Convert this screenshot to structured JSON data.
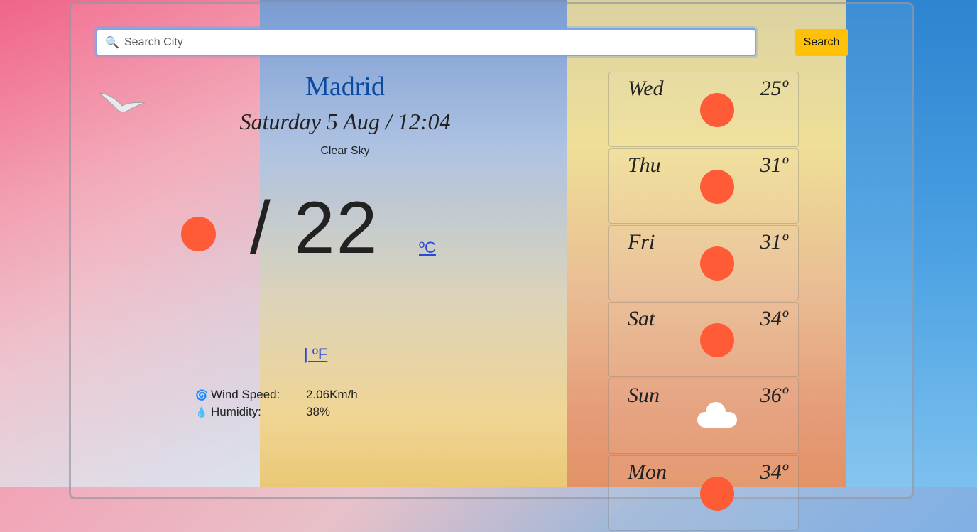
{
  "search": {
    "placeholder": "Search City",
    "button_label": "Search"
  },
  "current": {
    "city": "Madrid",
    "datetime": "Saturday 5 Aug / 12:04",
    "description": "Clear Sky",
    "temperature": "/ 22",
    "unit_c": "ºC",
    "unit_f": "| ºF",
    "icon": "sun-icon"
  },
  "stats": [
    {
      "icon": "wind-icon",
      "label": "Wind Speed:",
      "value": "2.06Km/h"
    },
    {
      "icon": "droplet-icon",
      "label": "Humidity:",
      "value": "38%"
    }
  ],
  "forecast": [
    {
      "day": "Wed",
      "temp": "25º",
      "icon": "sun-icon"
    },
    {
      "day": "Thu",
      "temp": "31º",
      "icon": "sun-icon"
    },
    {
      "day": "Fri",
      "temp": "31º",
      "icon": "sun-icon"
    },
    {
      "day": "Sat",
      "temp": "34º",
      "icon": "sun-icon"
    },
    {
      "day": "Sun",
      "temp": "36º",
      "icon": "cloud-icon"
    },
    {
      "day": "Mon",
      "temp": "34º",
      "icon": "sun-icon"
    }
  ],
  "colors": {
    "accent": "#ffc107",
    "sun": "#ff5b36",
    "city": "#0a4aa0",
    "link": "#2a49d6"
  }
}
